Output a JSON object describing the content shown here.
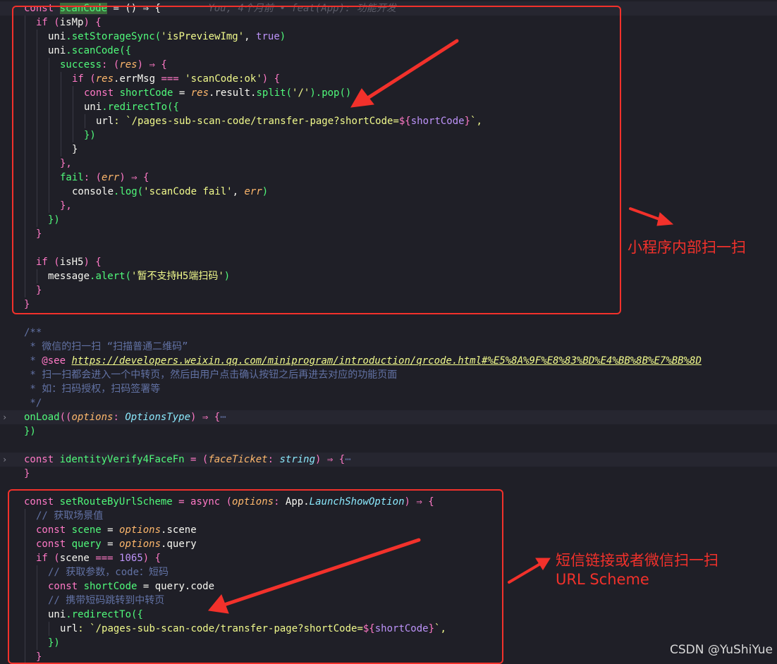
{
  "code": {
    "scan_header": {
      "a": "const ",
      "b": "scanCode",
      "c": " = () ⇒ {",
      "blame": "You, 4个月前 • feat(App): 功能开发"
    },
    "l1": {
      "a": "if (",
      "b": "isMp",
      "c": ") {"
    },
    "l2": {
      "a": "uni",
      "b": ".setStorageSync(",
      "c": "'isPreviewImg'",
      "d": ", ",
      "e": "true",
      "f": ")"
    },
    "l3": {
      "a": "uni",
      "b": ".scanCode({"
    },
    "l4": {
      "a": "success",
      "b": ": (",
      "c": "res",
      "d": ") ⇒ {"
    },
    "l5": {
      "a": "if (",
      "b": "res",
      "c": ".errMsg ",
      "d": "===",
      "e": " 'scanCode:ok'",
      "f": ") {"
    },
    "l6": {
      "a": "const ",
      "b": "shortCode",
      "c": " = ",
      "d": "res",
      "e": ".result.",
      "f": "split(",
      "g": "'/'",
      "h": ").pop()"
    },
    "l7": {
      "a": "uni",
      "b": ".redirectTo({"
    },
    "l8": {
      "a": "url",
      "b": ": `/pages-sub-scan-code/transfer-page?shortCode=",
      "c": "${",
      "d": "shortCode",
      "e": "}",
      "f": "`,"
    },
    "l9": "})",
    "l10": "}",
    "l11": "},",
    "l12": {
      "a": "fail",
      "b": ": (",
      "c": "err",
      "d": ") ⇒ {"
    },
    "l13": {
      "a": "console",
      "b": ".log(",
      "c": "'scanCode fail'",
      "d": ", ",
      "e": "err",
      "f": ")"
    },
    "l14": "},",
    "l15": "})",
    "l16": "}",
    "l17": {
      "a": "if (",
      "b": "isH5",
      "c": ") {"
    },
    "l18": {
      "a": "message",
      "b": ".alert(",
      "c": "'暂不支持H5端扫码'",
      "d": ")"
    },
    "l19": "}",
    "l20": "}",
    "doc1": "/**",
    "doc2": " * 微信的扫一扫 “扫描普通二维码”",
    "doc3": {
      "a": " * ",
      "b": "@see",
      "c": " ",
      "d": "https://developers.weixin.qq.com/miniprogram/introduction/qrcode.html#%E5%8A%9F%E8%83%BD%E4%BB%8B%E7%BB%8D"
    },
    "doc4": " * 扫一扫都会进入一个中转页，然后由用户点击确认按钮之后再进去对应的功能页面",
    "doc5": " * 如：扫码授权，扫码签署等",
    "doc6": " */",
    "onload": {
      "a": "onLoad",
      "b": "((",
      "c": "options",
      "d": ": ",
      "e": "OptionsType",
      "f": ") ⇒ {",
      "g": "⋯"
    },
    "onload_end": "})",
    "verify": {
      "a": "const ",
      "b": "identityVerify4FaceFn",
      "c": " = (",
      "d": "faceTicket",
      "e": ": ",
      "f": "string",
      "g": ") ⇒ {",
      "h": "⋯"
    },
    "verify_end": "}",
    "route": {
      "a": "const ",
      "b": "setRouteByUrlScheme",
      "c": " = ",
      "d": "async",
      "e": " (",
      "f": "options",
      "g": ": ",
      "h": "App",
      "i": ".",
      "j": "LaunchShowOption",
      "k": ") ⇒ {"
    },
    "r1": "// 获取场景值",
    "r2": {
      "a": "const ",
      "b": "scene",
      "c": " = ",
      "d": "options",
      "e": ".scene"
    },
    "r3": {
      "a": "const ",
      "b": "query",
      "c": " = ",
      "d": "options",
      "e": ".query"
    },
    "r4": {
      "a": "if (",
      "b": "scene",
      "c": " ",
      "d": "===",
      "e": " ",
      "f": "1065",
      "g": ") {"
    },
    "r5": "// 获取参数，code：短码",
    "r6": {
      "a": "const ",
      "b": "shortCode",
      "c": " = ",
      "d": "query",
      "e": ".code"
    },
    "r7": "// 携带短码跳转到中转页",
    "r8": {
      "a": "uni",
      "b": ".redirectTo({"
    },
    "r9": {
      "a": "url",
      "b": ": `/pages-sub-scan-code/transfer-page?shortCode=",
      "c": "${",
      "d": "shortCode",
      "e": "}",
      "f": "`,"
    },
    "r10": "})",
    "r11": "}",
    "fold_marker": "›"
  },
  "annotations": {
    "note1": "小程序内部扫一扫",
    "note2_line1": "短信链接或者微信扫一扫",
    "note2_line2": "URL Scheme",
    "accent": "#f2312b"
  },
  "watermark": "CSDN @YuShiYue"
}
